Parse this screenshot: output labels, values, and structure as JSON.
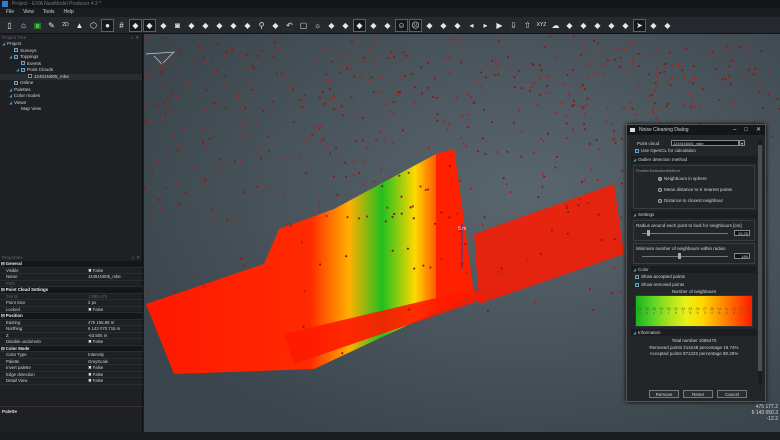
{
  "window": {
    "title": "Project - EIVA NaviModel Producer 4.2 *"
  },
  "menu": [
    "File",
    "View",
    "Tools",
    "Help"
  ],
  "toolbar": {
    "icons": [
      "new-icon",
      "open-icon",
      "save-icon",
      "connect-icon",
      "2d-icon",
      "north-icon",
      "3d-box-icon",
      "point-cloud-icon",
      "grid-icon",
      "outline-icon",
      "grid-surface-icon",
      "image-icon",
      "camera-icon",
      "ruler-icon",
      "profile-icon",
      "profile2-icon",
      "profile3-icon",
      "path-icon",
      "pin-icon",
      "pin-search-icon",
      "undo-path-icon",
      "crop-icon",
      "sun-icon",
      "palette-icon",
      "paint-icon",
      "square-icon",
      "brush-icon",
      "scatter-icon",
      "face-happy-icon",
      "face-sad-icon",
      "add-point-icon",
      "remove-point-icon",
      "clapper-icon",
      "rewind-icon",
      "forward-icon",
      "play-icon",
      "down-icon",
      "up-icon",
      "xyz-cloud-icon",
      "cloud-icon",
      "add-point2-icon",
      "remove-point2-icon",
      "layers-icon",
      "cluster-icon",
      "shield-icon",
      "pointer-icon",
      "cloud-up-icon",
      "cloud-filter-icon"
    ],
    "labels": {
      "2d": "2D",
      "xyz": "XYZ"
    }
  },
  "project_tree": {
    "title": "Project Tree",
    "items": [
      {
        "label": "Project",
        "level": 0,
        "expander": true,
        "check": false
      },
      {
        "label": "Surveys",
        "level": 1,
        "check": true
      },
      {
        "label": "Toppings",
        "level": 1,
        "expander": true,
        "check": true
      },
      {
        "label": "Events",
        "level": 2,
        "check": true
      },
      {
        "label": "Point Clouds",
        "level": 2,
        "expander": true,
        "check": true
      },
      {
        "label": "J2491N005_mbe",
        "level": 3,
        "check": false,
        "selected": true
      },
      {
        "label": "Online",
        "level": 1,
        "check": true
      },
      {
        "label": "Palettes",
        "level": 1,
        "expander": true
      },
      {
        "label": "Color modes",
        "level": 1,
        "expander": true
      },
      {
        "label": "Views",
        "level": 1,
        "expander": true
      },
      {
        "label": "Map View",
        "level": 2
      }
    ]
  },
  "properties": {
    "title": "Properties",
    "rows": [
      {
        "cat": "General"
      },
      {
        "k": "Visible",
        "v": "False",
        "x": true
      },
      {
        "k": "Name",
        "v": "J2491N005_mbe"
      },
      {
        "k": "Path",
        "v": "",
        "dim": true
      },
      {
        "cat": "Point Cloud Settings"
      },
      {
        "k": "Points",
        "v": "1 085 470",
        "dim": true
      },
      {
        "k": "Point Size",
        "v": "2 px"
      },
      {
        "k": "Locked",
        "v": "False",
        "x": true
      },
      {
        "cat": "Position"
      },
      {
        "k": "Easting",
        "v": "475 166.88 m"
      },
      {
        "k": "Northing",
        "v": "6 143 070.715 m"
      },
      {
        "k": "Z",
        "v": "-63.505 m"
      },
      {
        "k": "Disable undo/redo",
        "v": "False",
        "x": true
      },
      {
        "cat": "Color Mode"
      },
      {
        "k": "Color Type",
        "v": "Intensity"
      },
      {
        "k": "Palette",
        "v": "GreyScale"
      },
      {
        "k": "Invert palette",
        "v": "False",
        "x": true
      },
      {
        "k": "Edge detection",
        "v": "False",
        "x": true
      },
      {
        "k": "Detail View",
        "v": "False",
        "x": true
      }
    ]
  },
  "palette_panel": {
    "title": "Palette"
  },
  "viewport": {
    "label": "5 m",
    "coords": [
      "475 177.2",
      "6 143 050.3",
      "-12.2"
    ]
  },
  "dialog": {
    "title": "Noise Cleaning Dialog",
    "point_cloud_label": "Point cloud",
    "point_cloud_value": "J2491N005_mbe",
    "opencl_label": "Use OpenCL for calculation",
    "opencl_checked": true,
    "outlier_section": "Outlier detection method",
    "outlier_group": "PoutlierDetectionMethod",
    "methods": [
      {
        "label": "Neighbours in sphere",
        "selected": true
      },
      {
        "label": "Mean distance to K nearest points",
        "selected": false
      },
      {
        "label": "Distance to closest neighbour",
        "selected": false
      }
    ],
    "settings_section": "Settings",
    "radius_label": "Radius around each point to look for neighbours [cm]",
    "radius_value": "29.25",
    "radius_fraction": 0.06,
    "minimum_label": "Minimum number of neighbours within radius",
    "minimum_value": "189",
    "minimum_fraction": 0.4,
    "color_section": "Color",
    "show_accepted": "Show accepted points",
    "show_removed": "Show removed points",
    "legend_title": "Number of neighbours",
    "legend_top": [
      "24",
      "36",
      "33",
      "30",
      "32",
      "31",
      "32",
      "33",
      "26",
      "27",
      "26",
      "24",
      "24",
      "23",
      "21",
      "20"
    ],
    "legend_bottom": [
      "3",
      "6",
      "4",
      "3",
      "1",
      "6",
      "7",
      "5",
      "4",
      "2",
      "0",
      "6",
      "6",
      "6",
      "3",
      "1"
    ],
    "info_section": "Information",
    "total": "Total number 1085470",
    "removed": "Removed points 214248   percentage 19.74%",
    "accepted": "Accepted points 871222   percentage 80.26%",
    "remove_button": "Remove",
    "reset_button": "Reset",
    "cancel_button": "Cancel"
  },
  "colors": {
    "accent": "#2e9ad8",
    "accepted": "#22c322",
    "removed": "#ff1a00",
    "background": "#1e2023"
  }
}
